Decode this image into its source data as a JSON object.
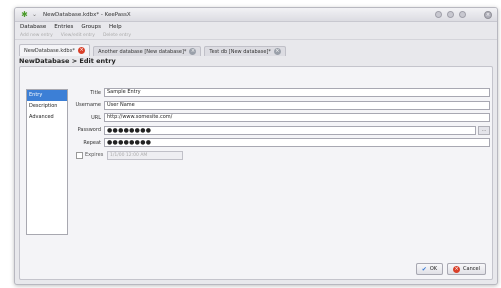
{
  "window": {
    "title": "NewDatabase.kdbx* - KeePassX"
  },
  "menu": [
    "Database",
    "Entries",
    "Groups",
    "Help"
  ],
  "toolbar": [
    "Add new entry",
    "View/edit entry",
    "Delete entry"
  ],
  "tabs": [
    {
      "label": "NewDatabase.kdbx*",
      "active": true
    },
    {
      "label": "Another database [New database]*",
      "active": false
    },
    {
      "label": "Test db [New database]*",
      "active": false
    }
  ],
  "header": {
    "path": "NewDatabase > Edit entry"
  },
  "sidebar": {
    "items": [
      {
        "label": "Entry"
      },
      {
        "label": "Description"
      },
      {
        "label": "Advanced"
      }
    ]
  },
  "form": {
    "title_label": "Title",
    "title_value": "Sample Entry",
    "username_label": "Username",
    "username_value": "User Name",
    "url_label": "URL",
    "url_value": "http://www.somesite.com/",
    "password_label": "Password",
    "password_value": "●●●●●●●●",
    "repeat_label": "Repeat",
    "repeat_value": "●●●●●●●●",
    "gen_label": "...",
    "expires_label": "Expires",
    "expires_value": "1/1/00 12:00 AM"
  },
  "buttons": {
    "ok": "OK",
    "cancel": "Cancel"
  }
}
